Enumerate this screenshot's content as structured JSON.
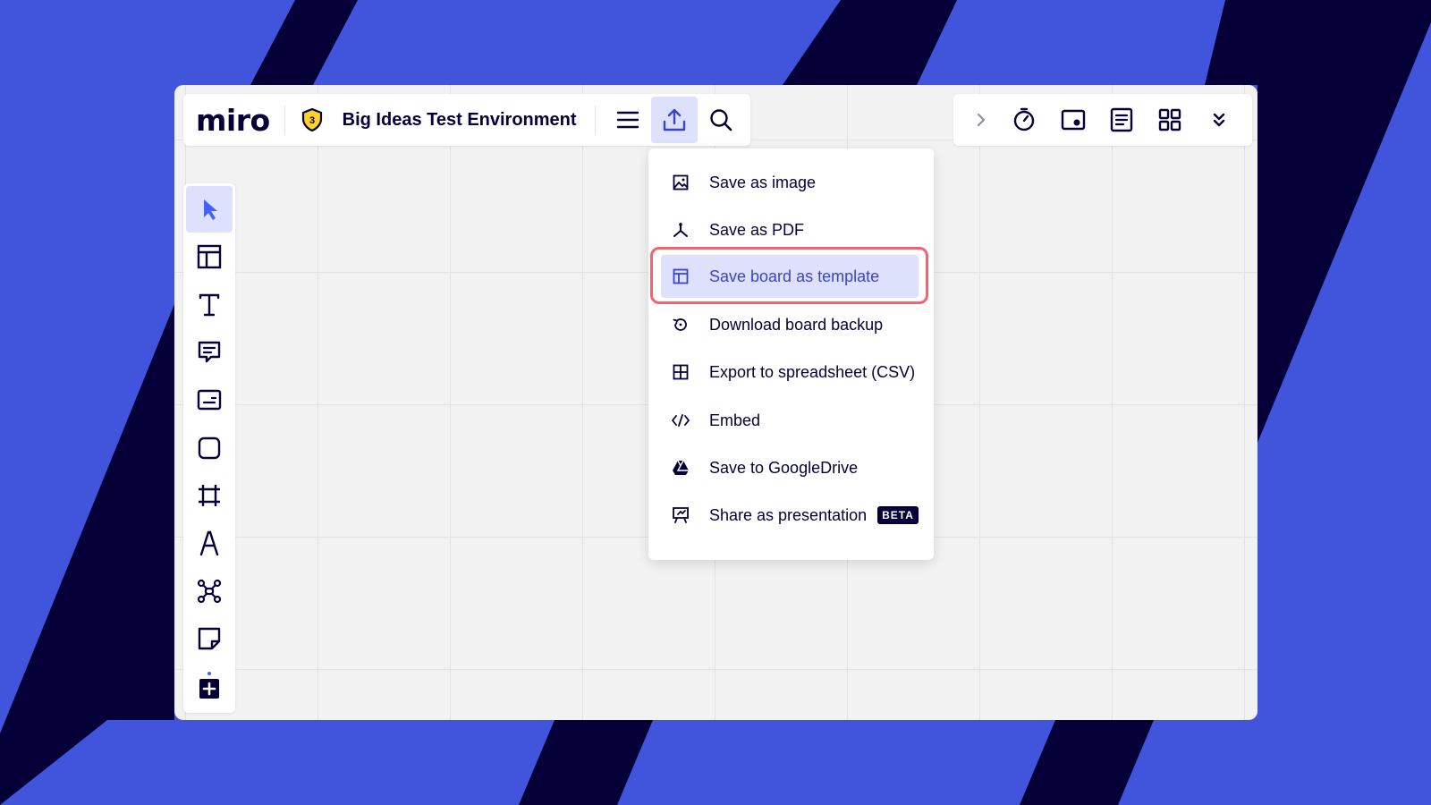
{
  "app": {
    "logo_text": "miro",
    "board_title": "Big Ideas Test Environment",
    "shield_badge": "3"
  },
  "colors": {
    "background_blue": "#4054dc",
    "background_stripe": "#050038",
    "accent": "#4262ff",
    "highlight_bg": "#dde1fb",
    "highlight_ring": "#f1656f",
    "canvas": "#f2f2f2"
  },
  "topbar_left": {
    "icons": [
      "shield-icon",
      "menu-icon",
      "export-icon",
      "search-icon"
    ]
  },
  "topbar_right": {
    "icons": [
      "chevron-right-icon",
      "timer-icon",
      "screen-share-icon",
      "notes-icon",
      "grid-icon",
      "chevrons-down-icon"
    ]
  },
  "toolbar": {
    "tools": [
      "select-tool",
      "templates-tool",
      "text-tool",
      "comment-tool",
      "card-tool",
      "shape-tool",
      "frame-tool",
      "pen-tool",
      "mind-map-tool",
      "sticky-note-tool",
      "more-tools"
    ]
  },
  "export_menu": {
    "items": [
      {
        "label": "Save as image",
        "icon": "image-icon"
      },
      {
        "label": "Save as PDF",
        "icon": "pdf-icon"
      },
      {
        "label": "Save board as template",
        "icon": "template-icon",
        "highlighted": true
      },
      {
        "label": "Download board backup",
        "icon": "backup-icon"
      },
      {
        "label": "Export to spreadsheet (CSV)",
        "icon": "spreadsheet-icon"
      },
      {
        "label": "Embed",
        "icon": "code-icon"
      },
      {
        "label": "Save to GoogleDrive",
        "icon": "google-drive-icon"
      },
      {
        "label": "Share as presentation",
        "icon": "presentation-icon",
        "badge": "BETA"
      }
    ]
  }
}
